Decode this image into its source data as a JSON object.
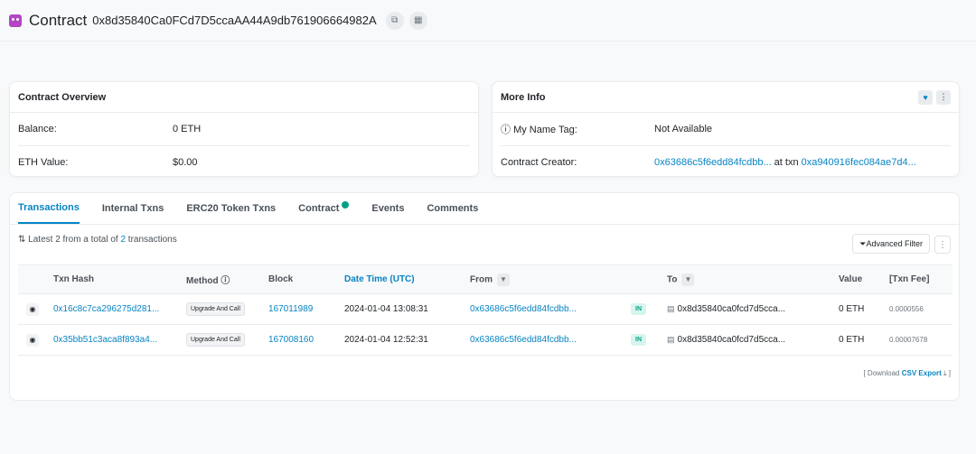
{
  "header": {
    "title": "Contract",
    "address": "0x8d35840Ca0FCd7D5ccaAA44A9db761906664982A",
    "copy_icon": "copy-icon",
    "qr_icon": "qr-icon"
  },
  "overview": {
    "title": "Contract Overview",
    "rows": [
      {
        "label": "Balance:",
        "value": "0 ETH"
      },
      {
        "label": "ETH Value:",
        "value": "$0.00"
      }
    ]
  },
  "more_info": {
    "title": "More Info",
    "name_tag_label": "My Name Tag:",
    "name_tag_value": "Not Available",
    "creator_label": "Contract Creator:",
    "creator_addr": "0x63686c5f6edd84fcdbb...",
    "at_txn": "at txn",
    "creator_txn": "0xa940916fec084ae7d4..."
  },
  "tabs": [
    "Transactions",
    "Internal Txns",
    "ERC20 Token Txns",
    "Contract",
    "Events",
    "Comments"
  ],
  "summary": {
    "prefix": "Latest 2 from a total of",
    "count": "2",
    "suffix": "transactions"
  },
  "advanced_filter": "Advanced Filter",
  "table": {
    "headers": {
      "hash": "Txn Hash",
      "method": "Method",
      "block": "Block",
      "date": "Date Time (UTC)",
      "from": "From",
      "to": "To",
      "value": "Value",
      "fee": "[Txn Fee]"
    },
    "rows": [
      {
        "hash": "0x16c8c7ca296275d281...",
        "method": "Upgrade And Call",
        "block": "167011989",
        "date": "2024-01-04 13:08:31",
        "from": "0x63686c5f6edd84fcdbb...",
        "dir": "IN",
        "to": "0x8d35840ca0fcd7d5cca...",
        "value": "0 ETH",
        "fee": "0.0000556"
      },
      {
        "hash": "0x35bb51c3aca8f893a4...",
        "method": "Upgrade And Call",
        "block": "167008160",
        "date": "2024-01-04 12:52:31",
        "from": "0x63686c5f6edd84fcdbb...",
        "dir": "IN",
        "to": "0x8d35840ca0fcd7d5cca...",
        "value": "0 ETH",
        "fee": "0.00007678"
      }
    ]
  },
  "export": {
    "prefix": "[ Download",
    "link": "CSV Export",
    "suffix": "]"
  }
}
